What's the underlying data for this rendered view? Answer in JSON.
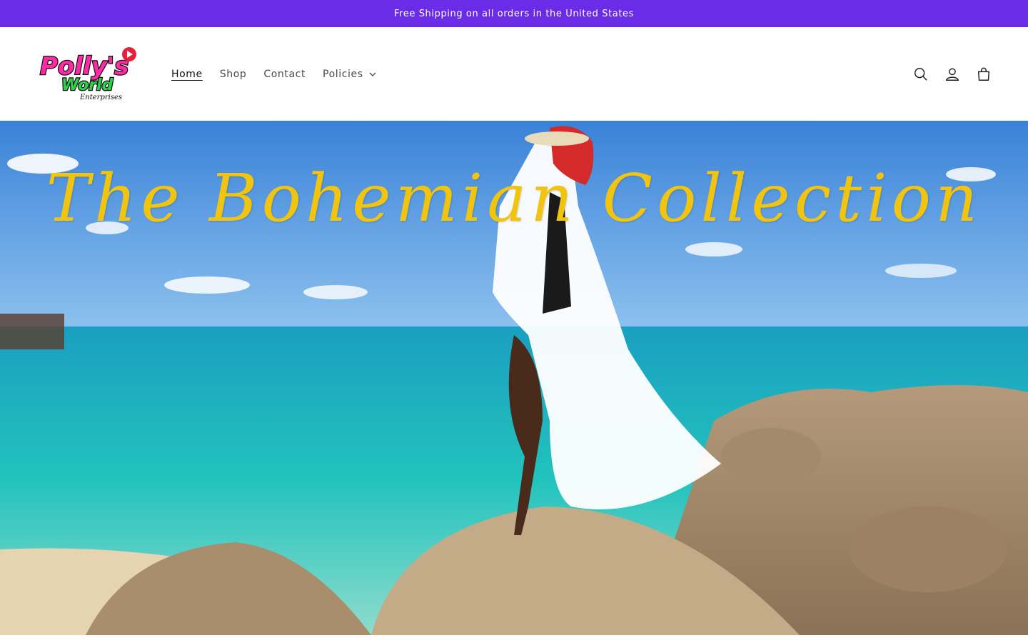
{
  "announcement": {
    "text": "Free Shipping on all orders in the United States"
  },
  "brand": {
    "logo_line1": "Polly's",
    "logo_line2": "World",
    "logo_line3": "Enterprises"
  },
  "nav": {
    "items": [
      {
        "label": "Home",
        "active": true
      },
      {
        "label": "Shop"
      },
      {
        "label": "Contact"
      },
      {
        "label": "Policies",
        "has_dropdown": true
      }
    ]
  },
  "header_icons": [
    "search-icon",
    "account-icon",
    "cart-icon"
  ],
  "hero": {
    "title": "The Bohemian Collection"
  },
  "colors": {
    "announcement_bg": "#6b2ce8",
    "hero_title": "#f1c40f",
    "sky": "#4a90d9",
    "sea": "#1fb5b8"
  }
}
